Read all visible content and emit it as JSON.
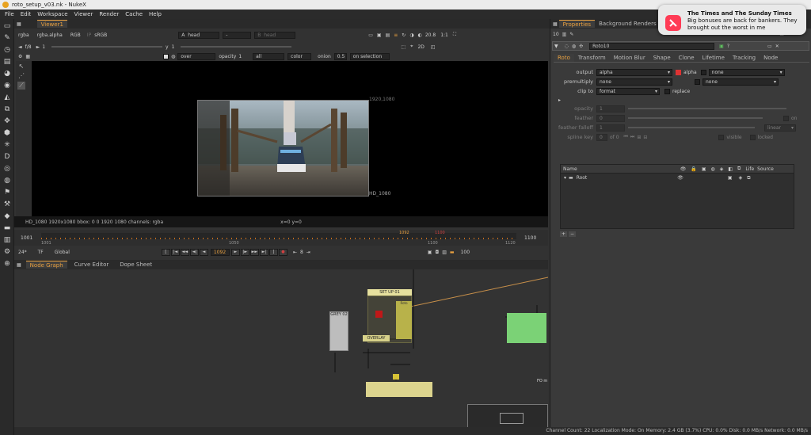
{
  "window": {
    "title": "roto_setup_v03.nk - NukeX"
  },
  "menu": [
    "File",
    "Edit",
    "Workspace",
    "Viewer",
    "Render",
    "Cache",
    "Help"
  ],
  "viewer_tab": "Viewer1",
  "viewer_row1": {
    "channels": "rgba",
    "layer": "rgba.alpha",
    "rgb": "RGB",
    "ip": "IP",
    "colorspace": "sRGB",
    "a_label": "A",
    "a_value": "head",
    "dash": "-",
    "b_label": "B",
    "b_value": "head",
    "gamma": "20.8",
    "zoom": "1:1",
    "mode": "2D"
  },
  "viewer_row2": {
    "fstop": "f/8",
    "fvalue": "1",
    "y_label": "y",
    "y_value": "1"
  },
  "viewer_row3": {
    "composite": "over",
    "opacity_label": "opacity",
    "opacity_value": "1",
    "channels_all": "all",
    "color": "color",
    "onion_label": "onion",
    "onion_value": "0.5",
    "on_selection": "on selection"
  },
  "format_top": "1920,1080",
  "format_bottom": "HD_1080",
  "viewer_status": {
    "info": "HD_1080 1920x1080  bbox: 0 0 1920 1080 channels: rgba",
    "coords": "x=0 y=0"
  },
  "timeline": {
    "start": "1001",
    "end": "1100",
    "ticks": [
      "1001",
      "1050",
      "1100",
      "1120"
    ],
    "marker_current": "1092",
    "marker_end": "1100",
    "fps": "24*",
    "tf": "TF",
    "global": "Global",
    "frame": "1092",
    "step": "8",
    "end_field": "100"
  },
  "nodegraph_tabs": [
    "Node Graph",
    "Curve Editor",
    "Dope Sheet"
  ],
  "nodes": {
    "setup": "SET UP 01",
    "overlay": "OVERLAY",
    "grey": "GREY 02",
    "roto_label": "Roto",
    "fo": "FO m"
  },
  "props": {
    "tabs": [
      "Properties",
      "Background Renders"
    ],
    "node_name": "Roto10",
    "subtabs": [
      "Roto",
      "Transform",
      "Motion Blur",
      "Shape",
      "Clone",
      "Lifetime",
      "Tracking",
      "Node"
    ],
    "output_label": "output",
    "output_value": "alpha",
    "output_alpha": "alpha",
    "output_none": "none",
    "premultiply_label": "premultiply",
    "premultiply_value": "none",
    "premultiply_none": "none",
    "clipto_label": "clip to",
    "clipto_value": "format",
    "replace": "replace",
    "opacity_label": "opacity",
    "opacity_value": "1",
    "feather_label": "feather",
    "feather_value": "0",
    "on": "on",
    "falloff_label": "feather falloff",
    "falloff_value": "1",
    "falloff_mode": "linear",
    "splinekey_label": "spline key",
    "splinekey_value": "0",
    "of": "of 0",
    "visible": "visible",
    "locked": "locked",
    "layers_headers": [
      "Name",
      "Life",
      "Source"
    ],
    "layer_root": "Root",
    "panel_value": "10"
  },
  "notification": {
    "title": "The Times and The Sunday Times",
    "line1": "Big bonuses are back for bankers. They",
    "line2": "brought out the worst in me"
  },
  "statusbar": "Channel Count: 22  Localization Mode: On  Memory: 2.4 GB (3.7%)  CPU: 0.0%  Disk: 0.0 MB/s  Network: 0.0 MB/s"
}
